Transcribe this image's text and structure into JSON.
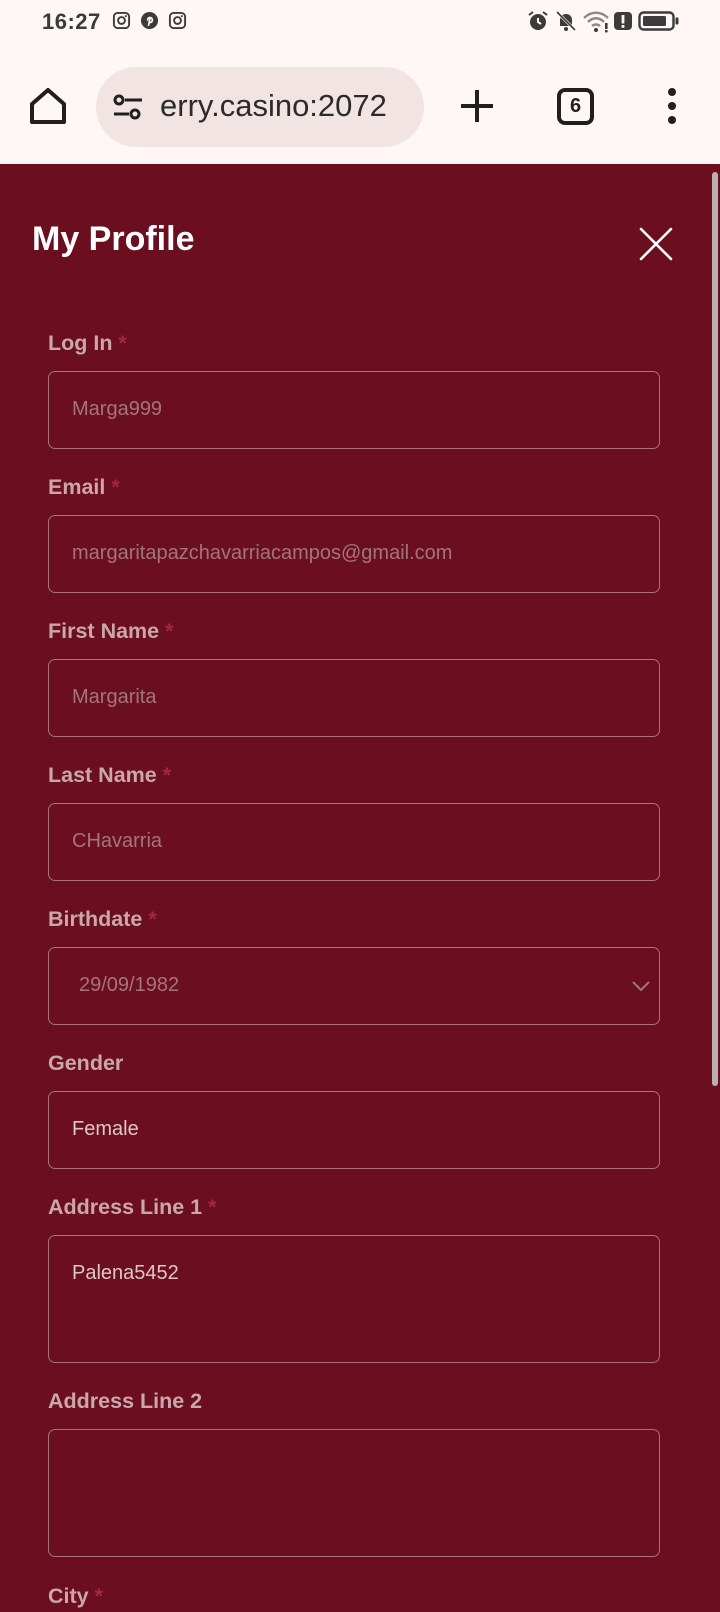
{
  "status_bar": {
    "time": "16:27",
    "left_icons": [
      "instagram-icon",
      "pinterest-icon",
      "instagram-icon"
    ],
    "right_icons": [
      "alarm-icon",
      "notifications-off-icon",
      "wifi-alert-icon",
      "alert-icon",
      "battery-icon"
    ]
  },
  "browser": {
    "url": "erry.casino:2072",
    "tab_count": "6",
    "icons": [
      "home-icon",
      "site-settings-icon",
      "plus-icon",
      "tabs-icon",
      "more-vert-icon"
    ]
  },
  "profile": {
    "title": "My Profile",
    "required_mark": "*",
    "fields": [
      {
        "label": "Log In",
        "required": true,
        "value": "Marga999"
      },
      {
        "label": "Email",
        "required": true,
        "value": "margaritapazchavarriacampos@gmail.com"
      },
      {
        "label": "First Name",
        "required": true,
        "value": "Margarita"
      },
      {
        "label": "Last Name",
        "required": true,
        "value": "CHavarria"
      },
      {
        "label": "Birthdate",
        "required": true,
        "value": "29/09/1982"
      },
      {
        "label": "Gender",
        "required": false,
        "value": "Female"
      },
      {
        "label": "Address Line 1",
        "required": true,
        "value": "Palena5452"
      },
      {
        "label": "Address Line 2",
        "required": false,
        "value": ""
      },
      {
        "label": "City",
        "required": true,
        "value": ""
      }
    ]
  },
  "colors": {
    "panel_bg": "#6b0f20",
    "label": "#c9a7ad",
    "required": "#a3283e",
    "field_border": "#a6727b",
    "browser_bg": "#fff7f6",
    "urlbar_bg": "#f2e4e3"
  }
}
